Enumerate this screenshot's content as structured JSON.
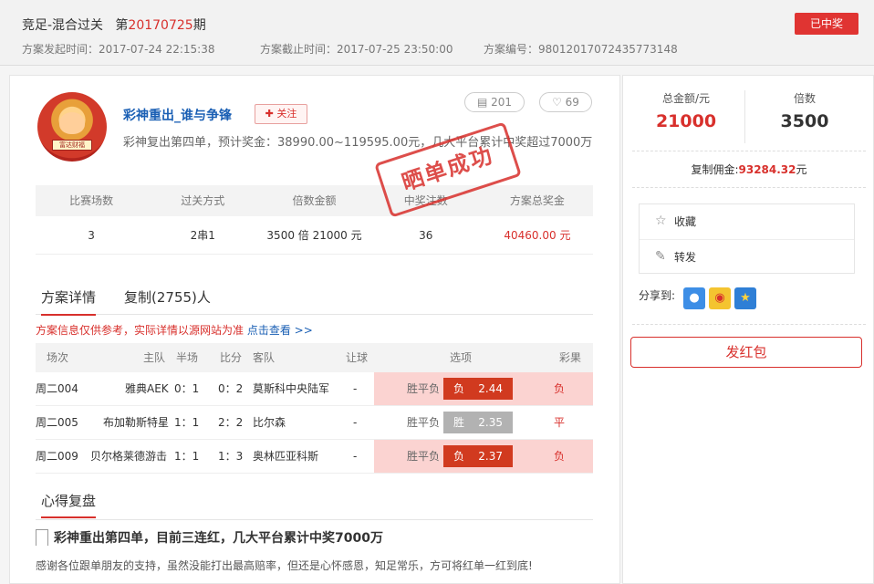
{
  "header": {
    "title_prefix": "竞足-混合过关",
    "issue_pre": "第",
    "issue_no": "20170725",
    "issue_post": "期",
    "start_label": "方案发起时间：",
    "start_time": "2017-07-24 22:15:38",
    "end_label": "方案截止时间：",
    "end_time": "2017-07-25 23:50:00",
    "id_label": "方案编号：",
    "plan_id": "98012017072435773148",
    "won_label": "已中奖"
  },
  "profile": {
    "avatar_text": "富达财福",
    "username": "彩神重出_谁与争锋",
    "follow_label": "✚ 关注",
    "comments": "201",
    "likes": "69",
    "description": "彩神复出第四单，预计奖金：38990.00~119595.00元，几大平台累计中奖超过7000万"
  },
  "stamp_text": "晒单成功",
  "stats": {
    "headers": [
      "比赛场数",
      "过关方式",
      "倍数金额",
      "中奖注数",
      "方案总奖金"
    ],
    "values": [
      "3",
      "2串1",
      "3500 倍  21000 元",
      "36",
      "40460.00 元"
    ]
  },
  "tabs": [
    "方案详情",
    "复制(2755)人"
  ],
  "notice": {
    "text": "方案信息仅供参考，实际详情以源网站为准 ",
    "link": "点击查看 >>"
  },
  "match_table": {
    "headers": [
      "场次",
      "主队",
      "半场",
      "比分",
      "客队",
      "让球",
      "选项",
      "彩果"
    ],
    "rows": [
      {
        "id": "周二004",
        "home": "雅典AEK",
        "half": "0：1",
        "score": "0：2",
        "away": "莫斯科中央陆军",
        "handicap": "-",
        "options": "胜平负",
        "pick": "负",
        "odds": "2.44",
        "result": "负"
      },
      {
        "id": "周二005",
        "home": "布加勒斯特星",
        "half": "1：1",
        "score": "2：2",
        "away": "比尔森",
        "handicap": "-",
        "options": "胜平负",
        "pick": "胜",
        "odds": "2.35",
        "result": "平"
      },
      {
        "id": "周二009",
        "home": "贝尔格莱德游击",
        "half": "1：1",
        "score": "1：3",
        "away": "奥林匹亚科斯",
        "handicap": "-",
        "options": "胜平负",
        "pick": "负",
        "odds": "2.37",
        "result": "负"
      }
    ]
  },
  "review": {
    "section_title": "心得复盘",
    "title": "彩神重出第四单，目前三连红，几大平台累计中奖7000万",
    "body": "感谢各位跟单朋友的支持，虽然没能打出最高赔率，但还是心怀感恩，知足常乐，方可将红单一红到底!"
  },
  "sidebar": {
    "total_label": "总金额/元",
    "total_value": "21000",
    "multiple_label": "倍数",
    "multiple_value": "3500",
    "commission_label": "复制佣金:",
    "commission_value": "93284.32",
    "commission_unit": "元",
    "favorite_label": "收藏",
    "forward_label": "转发",
    "share_label": "分享到:",
    "redpack_label": "发红包"
  },
  "colors": {
    "accent": "#d8302c",
    "link": "#1a5fb4",
    "loss_row": "#fbd3d1"
  }
}
